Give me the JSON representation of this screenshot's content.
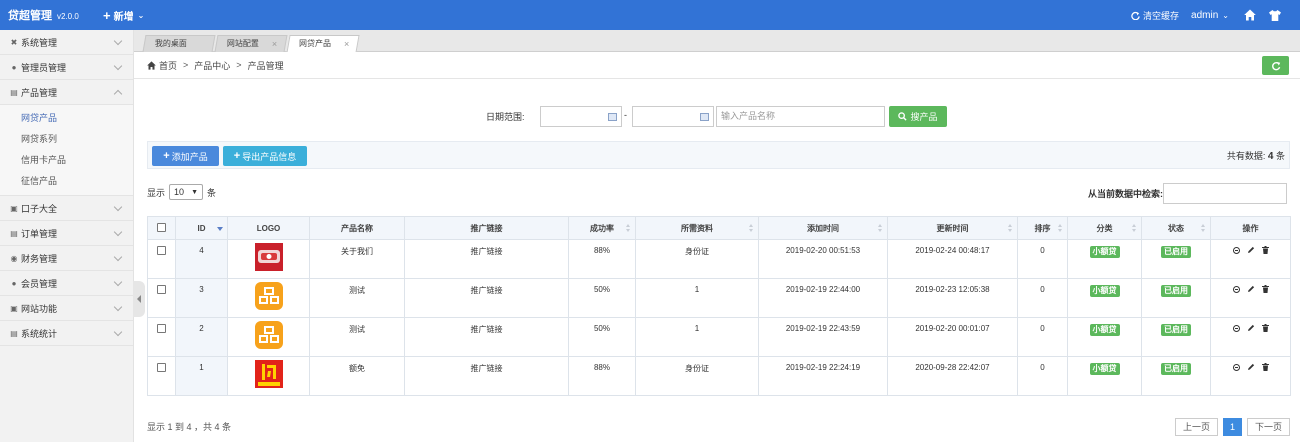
{
  "header": {
    "app_name": "贷超管理",
    "version": "v2.0.0",
    "new_label": "新增",
    "clear_cache_label": "清空缓存",
    "admin_label": "admin",
    "accent_color": "#3273d6"
  },
  "sidebar": {
    "items": [
      {
        "label": "系统管理",
        "icon": "wrench-icon"
      },
      {
        "label": "管理员管理",
        "icon": "user-icon"
      },
      {
        "label": "产品管理",
        "icon": "list-icon",
        "expanded": true
      },
      {
        "label": "口子大全",
        "icon": "square-icon"
      },
      {
        "label": "订单管理",
        "icon": "order-icon"
      },
      {
        "label": "财务管理",
        "icon": "finance-icon"
      },
      {
        "label": "会员管理",
        "icon": "member-icon"
      },
      {
        "label": "网站功能",
        "icon": "site-icon"
      },
      {
        "label": "系统统计",
        "icon": "stats-icon"
      }
    ],
    "submenu": [
      "网贷产品",
      "网贷系列",
      "信用卡产品",
      "征信产品"
    ]
  },
  "tabs": [
    {
      "label": "我的桌面"
    },
    {
      "label": "网站配置"
    },
    {
      "label": "网贷产品",
      "active": true
    }
  ],
  "breadcrumb": {
    "home": "首页",
    "sep": ">",
    "level1": "产品中心",
    "level2": "产品管理"
  },
  "search": {
    "date_label": "日期范围:",
    "dash": "-",
    "name_placeholder": "输入产品名称",
    "button_label": "搜产品"
  },
  "actions": {
    "add_label": "添加产品",
    "export_label": "导出产品信息",
    "total_prefix": "共有数据:",
    "total_count": "4",
    "total_suffix": "条"
  },
  "list_controls": {
    "show_label": "显示",
    "page_size": "10",
    "unit": "条",
    "filter_label": "从当前数据中检索:"
  },
  "table": {
    "columns": [
      "ID",
      "LOGO",
      "产品名称",
      "推广链接",
      "成功率",
      "所需资料",
      "添加时间",
      "更新时间",
      "排序",
      "分类",
      "状态",
      "操作"
    ],
    "rows": [
      {
        "id": "4",
        "logo": "red-card-logo",
        "name": "关于我们",
        "link": "推广链接",
        "rate": "88%",
        "docs": "身份证",
        "added": "2019-02-20 00:51:53",
        "updated": "2019-02-24 00:48:17",
        "sort": "0",
        "category": "小额贷",
        "status": "已启用"
      },
      {
        "id": "3",
        "logo": "orange-pin-logo",
        "name": "测试",
        "link": "推广链接",
        "rate": "50%",
        "docs": "1",
        "added": "2019-02-19 22:44:00",
        "updated": "2019-02-23 12:05:38",
        "sort": "0",
        "category": "小额贷",
        "status": "已启用"
      },
      {
        "id": "2",
        "logo": "orange-pin-logo",
        "name": "测试",
        "link": "推广链接",
        "rate": "50%",
        "docs": "1",
        "added": "2019-02-19 22:43:59",
        "updated": "2019-02-20 00:01:07",
        "sort": "0",
        "category": "小额贷",
        "status": "已启用"
      },
      {
        "id": "1",
        "logo": "red-flash-logo",
        "name": "额免",
        "link": "推广链接",
        "rate": "88%",
        "docs": "身份证",
        "added": "2019-02-19 22:24:19",
        "updated": "2020-09-28 22:42:07",
        "sort": "0",
        "category": "小额贷",
        "status": "已启用"
      }
    ]
  },
  "footer": {
    "info": "显示 1 到 4 ，共 4 条",
    "prev": "上一页",
    "current": "1",
    "next": "下一页"
  }
}
